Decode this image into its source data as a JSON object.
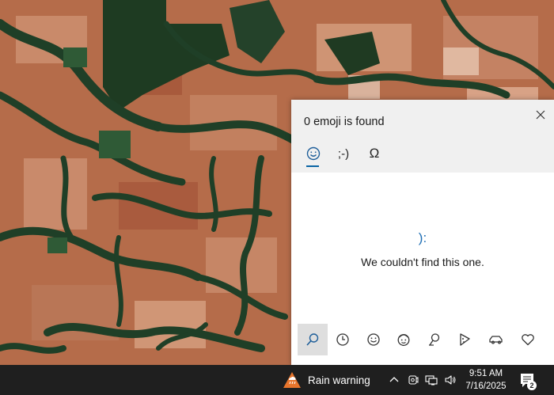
{
  "emoji_panel": {
    "title": "0 emoji is found",
    "category_tabs": [
      {
        "name": "emoji",
        "glyph": "☺"
      },
      {
        "name": "kaomoji",
        "glyph": ";-)"
      },
      {
        "name": "symbols",
        "glyph": "Ω"
      }
    ],
    "empty_state": {
      "face": "):",
      "message": "We couldn't find this one."
    },
    "bottom_tabs": [
      "search",
      "recent",
      "smiley",
      "people",
      "location",
      "food",
      "transport",
      "heart"
    ],
    "active_bottom_tab": "search",
    "accent_color": "#0a64a4"
  },
  "taskbar": {
    "weather": {
      "text": "Rain warning",
      "icon": "rain-warning-icon",
      "color": "#e8752c"
    },
    "clock": {
      "time": "9:51 AM",
      "date": "7/16/2025"
    },
    "notification_count": "2"
  }
}
